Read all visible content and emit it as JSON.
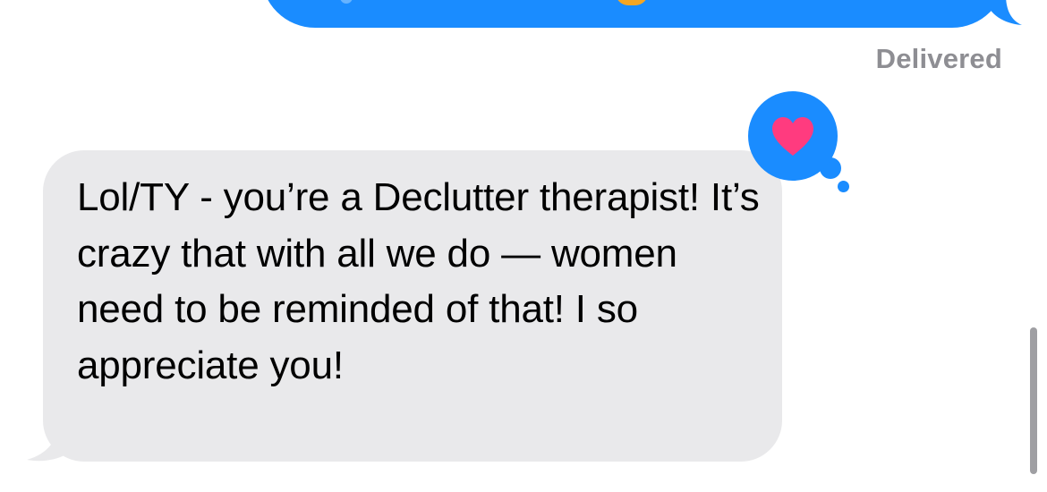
{
  "thread": {
    "sent_message": {
      "status": "Delivered",
      "bubble_color": "#1a8cff"
    },
    "received_message": {
      "text": "Lol/TY - you’re a Declutter therapist! It’s crazy that with all we do — women need to be reminded of that! I so appreciate you!",
      "bubble_color": "#e9e9eb"
    },
    "reaction": {
      "type": "heart-icon",
      "heart_color": "#ff3b7f",
      "badge_color": "#1a8cff"
    }
  },
  "colors": {
    "status_text": "#8e8e93",
    "background": "#ffffff"
  }
}
